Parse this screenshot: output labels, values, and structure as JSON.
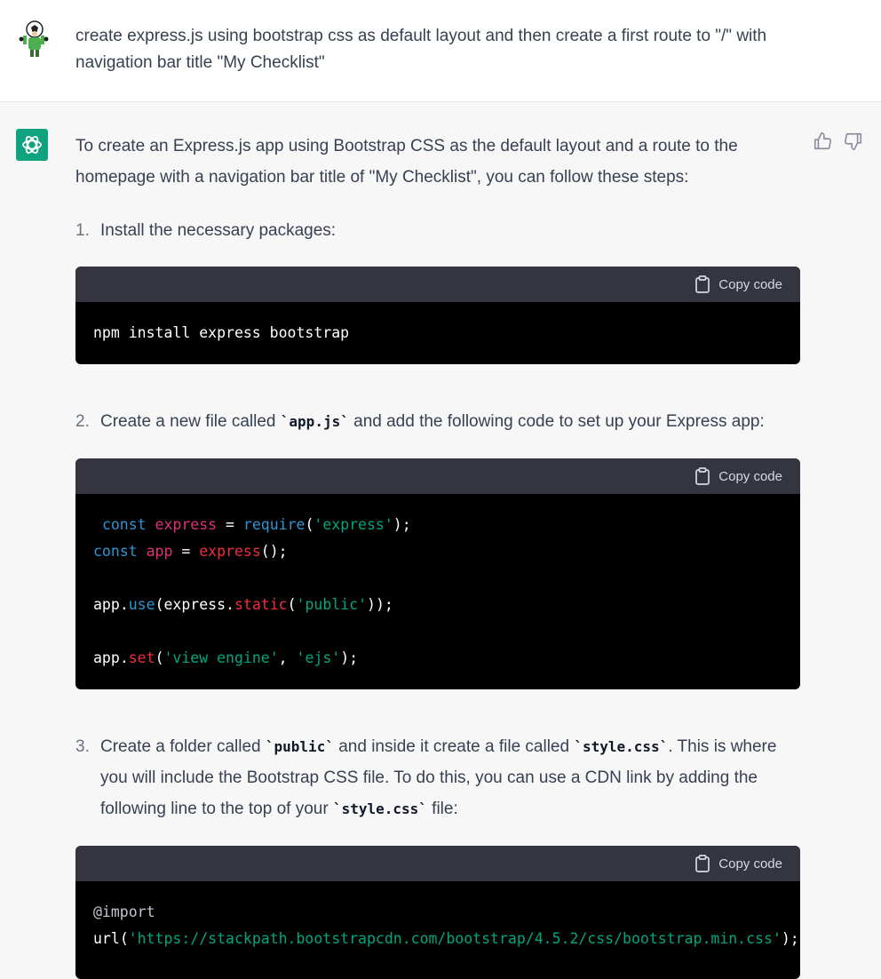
{
  "user": {
    "message": "create express.js using bootstrap css as default layout and then create a first route to \"/\" with navigation bar title \"My Checklist\""
  },
  "assistant": {
    "intro": "To create an Express.js app using Bootstrap CSS as the default layout and a route to the homepage with a navigation bar title of \"My Checklist\", you can follow these steps:",
    "copy_label": "Copy code",
    "steps": [
      {
        "num": "1.",
        "text": "Install the necessary packages:"
      },
      {
        "num": "2.",
        "text_a": "Create a new file called ",
        "code_a": "`app.js`",
        "text_b": " and add the following code to set up your Express app:"
      },
      {
        "num": "3.",
        "text_a": "Create a folder called ",
        "code_a": "`public`",
        "text_b": " and inside it create a file called ",
        "code_b": "`style.css`",
        "text_c": ". This is where you will include the Bootstrap CSS file. To do this, you can use a CDN link by adding the following line to the top of your ",
        "code_c": "`style.css`",
        "text_d": " file:"
      }
    ],
    "code1": {
      "line1": "npm install express bootstrap"
    },
    "code2": {
      "kw_const": "const",
      "var_express": "express",
      "eq": " = ",
      "fn_require": "require",
      "str_express": "'express'",
      "end1": ");",
      "var_app": "app",
      "fn_express": "express",
      "end2": "();",
      "app": "app",
      "dot": ".",
      "fn_use": "use",
      "paren": "(",
      "express_dot": "express.",
      "fn_static": "static",
      "str_public": "'public'",
      "end3": "));",
      "fn_set": "set",
      "str_view": "'view engine'",
      "comma": ", ",
      "str_ejs": "'ejs'",
      "end4": ");"
    },
    "code3": {
      "at_import": "@import",
      "url": "url",
      "str_url": "'https://stackpath.bootstrapcdn.com/bootstrap/4.5.2/css/bootstrap.min.css'",
      "end": ");"
    }
  },
  "colors": {
    "accent": "#10a37f",
    "code_bg": "#000000",
    "code_header": "#343541"
  },
  "icons": [
    "user-avatar-icon",
    "openai-logo-icon",
    "thumbs-up-icon",
    "thumbs-down-icon",
    "clipboard-icon"
  ]
}
